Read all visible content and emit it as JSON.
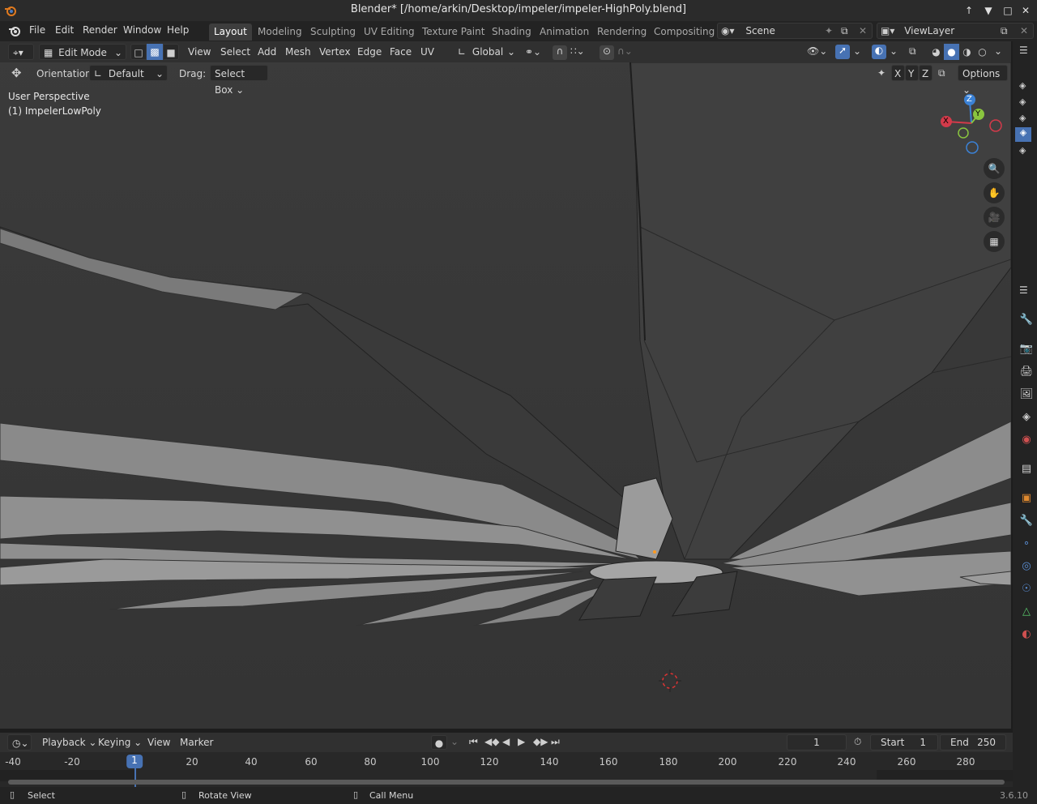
{
  "window": {
    "title": "Blender* [/home/arkin/Desktop/impeler/impeler-HighPoly.blend]"
  },
  "menu": [
    "File",
    "Edit",
    "Render",
    "Window",
    "Help"
  ],
  "workspaces": [
    "Layout",
    "Modeling",
    "Sculpting",
    "UV Editing",
    "Texture Paint",
    "Shading",
    "Animation",
    "Rendering",
    "Compositing"
  ],
  "active_workspace": "Layout",
  "scene": {
    "name": "Scene",
    "view_layer": "ViewLayer"
  },
  "header": {
    "mode": "Edit Mode",
    "menus": [
      "View",
      "Select",
      "Add",
      "Mesh",
      "Vertex",
      "Edge",
      "Face",
      "UV"
    ],
    "transform_orientation": "Global"
  },
  "tool_settings": {
    "orientation_label": "Orientation:",
    "orientation_value": "Default",
    "drag_label": "Drag:",
    "drag_value": "Select Box",
    "axes": [
      "X",
      "Y",
      "Z"
    ],
    "options_label": "Options"
  },
  "viewport": {
    "view_name": "User Perspective",
    "object_name": "(1) ImpelerLowPoly",
    "gizmo": {
      "x": "X",
      "y": "Y",
      "z": "Z"
    }
  },
  "timeline": {
    "menus": [
      "Playback",
      "Keying",
      "View",
      "Marker"
    ],
    "current_frame": "1",
    "start_label": "Start",
    "start": "1",
    "end_label": "End",
    "end": "250",
    "ticks": [
      "-40",
      "-20",
      "1",
      "20",
      "40",
      "60",
      "80",
      "100",
      "120",
      "140",
      "160",
      "180",
      "200",
      "220",
      "240",
      "260",
      "280"
    ]
  },
  "status": {
    "select": "Select",
    "rotate": "Rotate View",
    "call_menu": "Call Menu",
    "version": "3.6.10"
  },
  "colors": {
    "accent": "#4772b3",
    "viewport_bg": "#393939",
    "header": "#303030"
  }
}
